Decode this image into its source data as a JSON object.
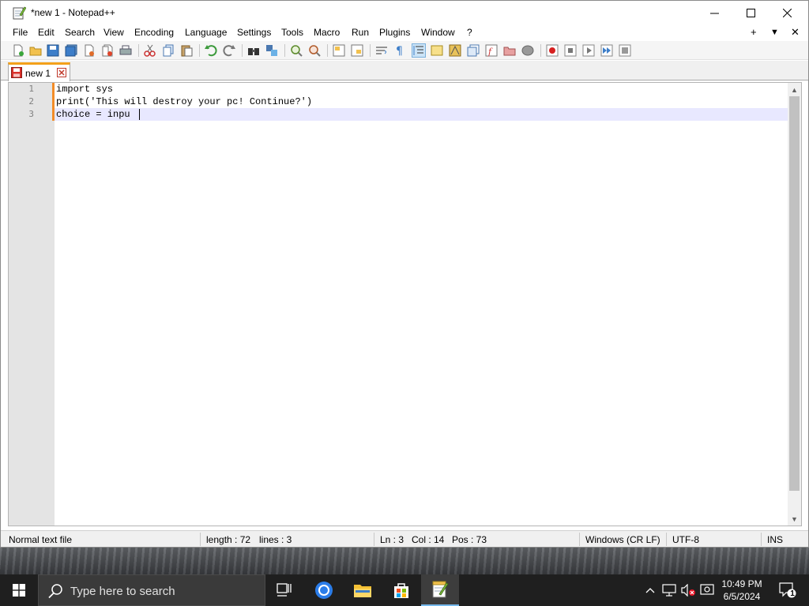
{
  "window": {
    "title": "*new 1 - Notepad++",
    "minimize_glyph": "minimize-icon",
    "maximize_glyph": "maximize-icon",
    "close_glyph": "close-icon"
  },
  "menu": {
    "items": [
      "File",
      "Edit",
      "Search",
      "View",
      "Encoding",
      "Language",
      "Settings",
      "Tools",
      "Macro",
      "Run",
      "Plugins",
      "Window",
      "?"
    ],
    "right_plus": "+",
    "right_down": "▼",
    "right_close": "✕"
  },
  "tabs": [
    {
      "label": "new 1"
    }
  ],
  "editor": {
    "lines": [
      {
        "num": "1",
        "text": "import sys"
      },
      {
        "num": "2",
        "text": "print('This will destroy your pc! Continue?')"
      },
      {
        "num": "3",
        "text": "choice = inpu"
      }
    ]
  },
  "status": {
    "file_type": "Normal text file",
    "length": "length : 72",
    "lines": "lines : 3",
    "ln": "Ln : 3",
    "col": "Col : 14",
    "pos": "Pos : 73",
    "eol": "Windows (CR LF)",
    "encoding": "UTF-8",
    "mode": "INS"
  },
  "taskbar": {
    "search_placeholder": "Type here to search",
    "time": "10:49 PM",
    "date": "6/5/2024",
    "notification_count": "1"
  },
  "colors": {
    "accent_tab": "#f3a01a",
    "current_line": "#e8e8ff",
    "taskbar": "#1f1f1f"
  }
}
